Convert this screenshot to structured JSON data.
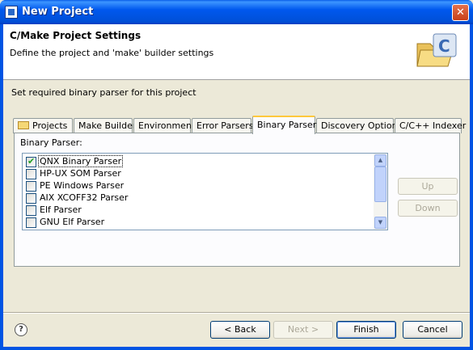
{
  "window": {
    "title": "New Project",
    "close_label": "✕"
  },
  "header": {
    "title": "C/Make Project Settings",
    "description": "Define the project and 'make' builder settings",
    "image_icon": "c-project-folder-icon"
  },
  "instruction": "Set required binary parser for this project",
  "tabs": [
    {
      "label": "Projects",
      "icon": "folder-icon"
    },
    {
      "label": "Make Builder"
    },
    {
      "label": "Environment"
    },
    {
      "label": "Error Parsers"
    },
    {
      "label": "Binary Parser",
      "active": true
    },
    {
      "label": "Discovery Options"
    },
    {
      "label": "C/C++ Indexer"
    }
  ],
  "panel": {
    "label": "Binary Parser:",
    "parsers": [
      {
        "label": "QNX Binary Parser",
        "checked": true
      },
      {
        "label": "HP-UX SOM Parser",
        "checked": false
      },
      {
        "label": "PE Windows Parser",
        "checked": false
      },
      {
        "label": "AIX XCOFF32 Parser",
        "checked": false
      },
      {
        "label": "Elf Parser",
        "checked": false
      },
      {
        "label": "GNU Elf Parser",
        "checked": false
      }
    ],
    "up_label": "Up",
    "down_label": "Down"
  },
  "footer": {
    "help_icon": "help-icon",
    "back_label": "< Back",
    "next_label": "Next >",
    "finish_label": "Finish",
    "cancel_label": "Cancel"
  }
}
